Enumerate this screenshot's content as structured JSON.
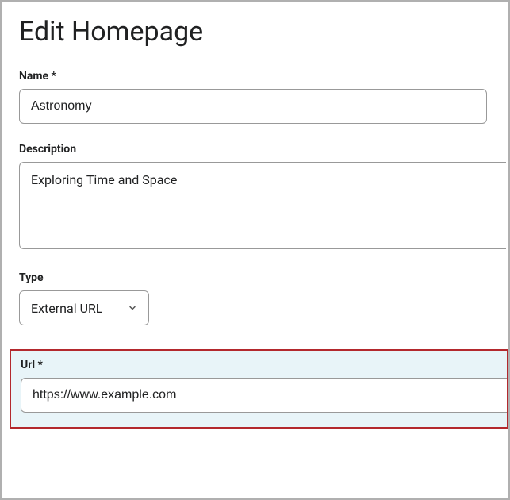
{
  "page_title": "Edit Homepage",
  "fields": {
    "name": {
      "label": "Name",
      "value": "Astronomy"
    },
    "description": {
      "label": "Description",
      "value": "Exploring Time and Space"
    },
    "type": {
      "label": "Type",
      "selected": "External URL"
    },
    "url": {
      "label": "Url",
      "value": "https://www.example.com"
    }
  }
}
